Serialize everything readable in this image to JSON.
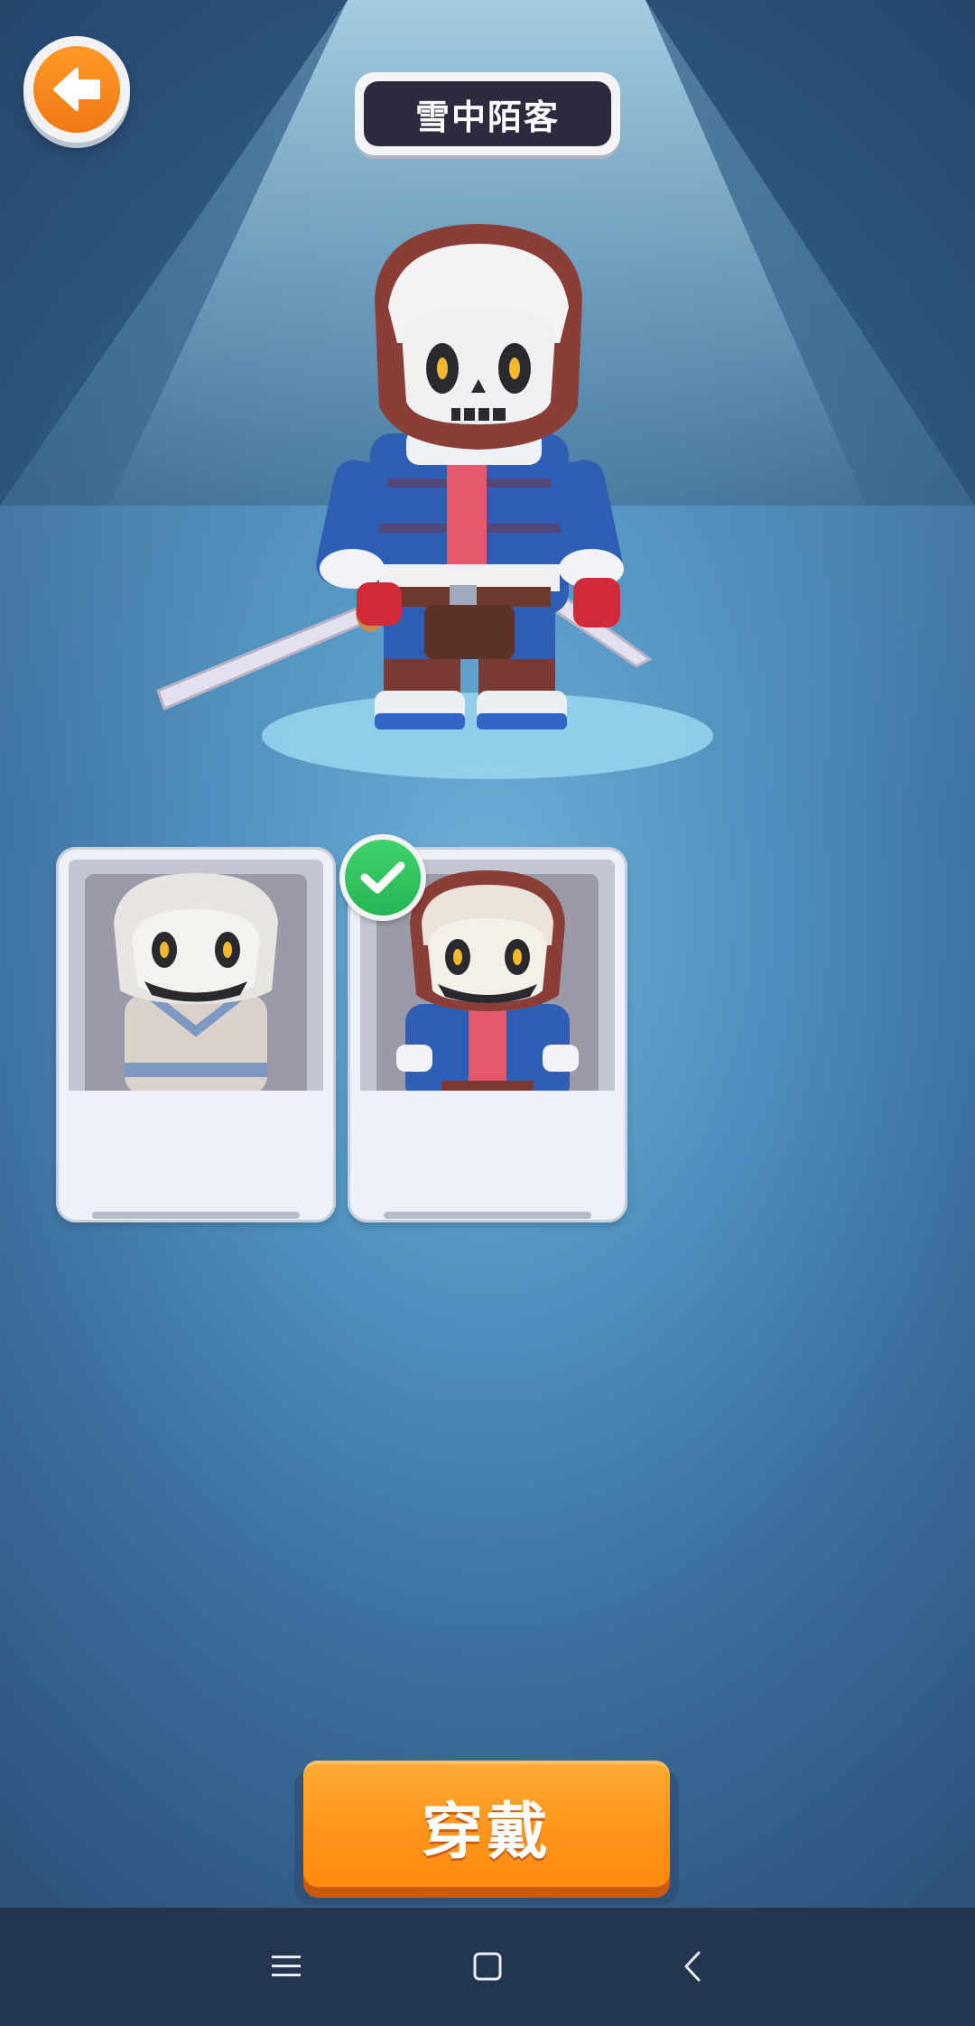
{
  "header": {
    "back_icon": "arrow-left-icon",
    "title": "雪中陌客"
  },
  "preview": {
    "character_icon": "skeleton-ninja-snow-outfit"
  },
  "skins": [
    {
      "icon": "skeleton-ninja-white-outfit",
      "selected": false
    },
    {
      "icon": "skeleton-ninja-snow-outfit",
      "selected": true
    }
  ],
  "selected_badge_icon": "checkmark-icon",
  "actions": {
    "wear_label": "穿戴"
  },
  "navbar": {
    "menu_icon": "menu-icon",
    "home_icon": "home-square-icon",
    "back_icon": "chevron-left-icon"
  },
  "colors": {
    "accent_orange": "#ff961c",
    "check_green": "#27b455",
    "title_dark": "#2c2b3d",
    "navbar": "#24364f"
  }
}
